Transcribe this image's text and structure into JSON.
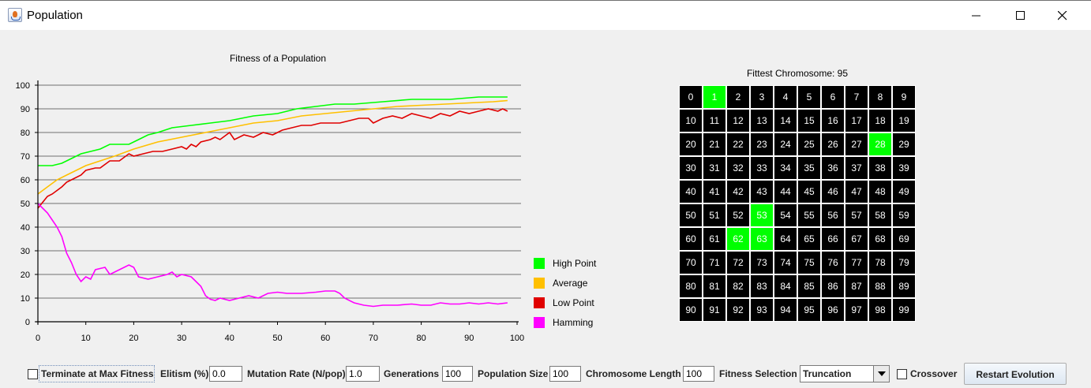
{
  "window": {
    "title": "Population"
  },
  "chart_data": {
    "type": "line",
    "title": "Fitness of a Population",
    "xlabel": "",
    "ylabel": "",
    "xlim": [
      0,
      100
    ],
    "ylim": [
      0,
      105
    ],
    "xticks": [
      0,
      10,
      20,
      30,
      40,
      50,
      60,
      70,
      80,
      90,
      100
    ],
    "yticks": [
      0,
      10,
      20,
      30,
      40,
      50,
      60,
      70,
      80,
      90,
      100
    ],
    "grid": "horizontal",
    "legend_position": "bottom-right",
    "series": [
      {
        "name": "High Point",
        "color": "#00ff00",
        "x": [
          0,
          3,
          5,
          7,
          9,
          11,
          13,
          15,
          19,
          21,
          23,
          25,
          28,
          32,
          36,
          40,
          45,
          50,
          54,
          58,
          62,
          66,
          72,
          78,
          86,
          92,
          98
        ],
        "y": [
          66,
          66,
          67,
          69,
          71,
          72,
          73,
          75,
          75,
          77,
          79,
          80,
          82,
          83,
          84,
          85,
          87,
          88,
          90,
          91,
          92,
          92,
          93,
          94,
          94,
          95,
          95
        ]
      },
      {
        "name": "Average",
        "color": "#ffc000",
        "x": [
          0,
          2,
          4,
          6,
          8,
          10,
          13,
          16,
          20,
          25,
          30,
          35,
          40,
          45,
          50,
          55,
          60,
          65,
          70,
          75,
          80,
          85,
          90,
          95,
          98
        ],
        "y": [
          54,
          57,
          60,
          62,
          64,
          66,
          68,
          70,
          73,
          76,
          78,
          80,
          82,
          84,
          85,
          87,
          88,
          89,
          90,
          91,
          91.5,
          92,
          92.5,
          93,
          93.5
        ]
      },
      {
        "name": "Low Point",
        "color": "#e00000",
        "x": [
          0,
          2,
          3,
          5,
          6,
          7,
          9,
          10,
          12,
          13,
          15,
          17,
          19,
          20,
          22,
          24,
          26,
          28,
          30,
          31,
          32,
          33,
          34,
          36,
          37,
          38,
          40,
          41,
          43,
          45,
          47,
          49,
          51,
          53,
          55,
          57,
          59,
          61,
          63,
          65,
          67,
          69,
          70,
          72,
          74,
          76,
          78,
          80,
          82,
          84,
          86,
          88,
          90,
          92,
          94,
          96,
          97,
          98
        ],
        "y": [
          48,
          53,
          54,
          57,
          59,
          60,
          62,
          64,
          65,
          65,
          68,
          68,
          71,
          70,
          71,
          72,
          72,
          73,
          74,
          73,
          75,
          74,
          76,
          77,
          78,
          77,
          80,
          77,
          79,
          78,
          80,
          79,
          81,
          82,
          83,
          83,
          84,
          84,
          84,
          85,
          86,
          86,
          84,
          86,
          87,
          86,
          88,
          87,
          86,
          88,
          87,
          89,
          88,
          89,
          90,
          89,
          90,
          89
        ]
      },
      {
        "name": "Hamming",
        "color": "#ff00ff",
        "x": [
          0,
          2,
          3,
          4,
          5,
          6,
          7,
          8,
          9,
          10,
          11,
          12,
          14,
          15,
          17,
          19,
          20,
          21,
          23,
          25,
          27,
          28,
          29,
          30,
          32,
          33,
          34,
          35,
          36,
          37,
          38,
          40,
          42,
          44,
          46,
          48,
          50,
          52,
          55,
          58,
          60,
          62,
          63,
          64,
          66,
          68,
          70,
          72,
          75,
          78,
          80,
          82,
          84,
          86,
          88,
          90,
          92,
          94,
          96,
          98
        ],
        "y": [
          50,
          46,
          43,
          40,
          36,
          29,
          25,
          20,
          17,
          19,
          18,
          22,
          23,
          20,
          22,
          24,
          23,
          19,
          18,
          19,
          20,
          21,
          19,
          20,
          19,
          17,
          15,
          11,
          9.5,
          9,
          10,
          9,
          10,
          11,
          10,
          12,
          12.5,
          12,
          12,
          12.5,
          13,
          13,
          12,
          10,
          8,
          7,
          6.5,
          7,
          7,
          7.5,
          7,
          7,
          8,
          7.5,
          7.5,
          8,
          7.5,
          8,
          7.5,
          8
        ]
      }
    ]
  },
  "grid_panel": {
    "title": "Fittest Chromosome: 95",
    "on_color": "#00ff00",
    "off_color": "#000000",
    "cells": [
      "0",
      "1",
      "2",
      "3",
      "4",
      "5",
      "6",
      "7",
      "8",
      "9",
      "10",
      "11",
      "12",
      "13",
      "14",
      "15",
      "16",
      "17",
      "18",
      "19",
      "20",
      "21",
      "22",
      "23",
      "24",
      "25",
      "26",
      "27",
      "28",
      "29",
      "30",
      "31",
      "32",
      "33",
      "34",
      "35",
      "36",
      "37",
      "38",
      "39",
      "40",
      "41",
      "42",
      "43",
      "44",
      "45",
      "46",
      "47",
      "48",
      "49",
      "50",
      "51",
      "52",
      "53",
      "54",
      "55",
      "56",
      "57",
      "58",
      "59",
      "60",
      "61",
      "62",
      "63",
      "64",
      "65",
      "66",
      "67",
      "68",
      "69",
      "70",
      "71",
      "72",
      "73",
      "74",
      "75",
      "76",
      "77",
      "78",
      "79",
      "80",
      "81",
      "82",
      "83",
      "84",
      "85",
      "86",
      "87",
      "88",
      "89",
      "90",
      "91",
      "92",
      "93",
      "94",
      "95",
      "96",
      "97",
      "98",
      "99"
    ],
    "active": [
      1,
      28,
      53,
      62,
      63
    ]
  },
  "controls": {
    "terminate_label": "Terminate at Max Fitness",
    "elitism_label": "Elitism (%)",
    "elitism_value": "0.0",
    "mutation_label": "Mutation Rate (N/pop)",
    "mutation_value": "1.0",
    "generations_label": "Generations",
    "generations_value": "100",
    "population_label": "Population Size",
    "population_value": "100",
    "chromosome_label": "Chromosome Length",
    "chromosome_value": "100",
    "selection_label": "Fitness Selection",
    "selection_value": "Truncation",
    "crossover_label": "Crossover",
    "restart_label": "Restart Evolution"
  }
}
